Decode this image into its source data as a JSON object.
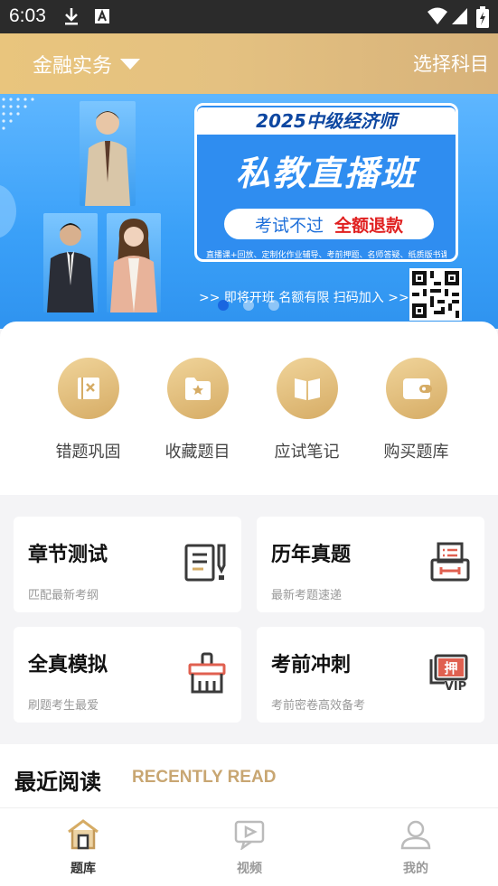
{
  "status_bar": {
    "time": "6:03",
    "icons": [
      "download-icon",
      "font-icon",
      "wifi-icon",
      "signal-icon",
      "battery-icon"
    ]
  },
  "header": {
    "subject": "金融实务",
    "choose_subject": "选择科目"
  },
  "banner": {
    "year_line": "2025中级经济师",
    "title": "私教直播班",
    "pill_left": "考试不过",
    "pill_right": "全额退款",
    "features": "直播课+回放、定制化作业辅导、考前押题、名师答疑、纸质版书课包",
    "cta": ">> 即将开班 名额有限 扫码加入 >>",
    "carousel_count": 3,
    "carousel_active": 0
  },
  "quick_actions": [
    {
      "label": "错题巩固",
      "icon": "wrong-questions-icon"
    },
    {
      "label": "收藏题目",
      "icon": "favorite-folder-icon"
    },
    {
      "label": "应试笔记",
      "icon": "notes-book-icon"
    },
    {
      "label": "购买题库",
      "icon": "wallet-icon"
    }
  ],
  "cards": [
    {
      "title": "章节测试",
      "subtitle": "匹配最新考纲",
      "icon": "chapter-test-icon"
    },
    {
      "title": "历年真题",
      "subtitle": "最新考题速递",
      "icon": "past-papers-icon"
    },
    {
      "title": "全真模拟",
      "subtitle": "刷题考生最爱",
      "icon": "mock-exam-icon"
    },
    {
      "title": "考前冲刺",
      "subtitle": "考前密卷高效备考",
      "icon": "vip-sprint-icon"
    }
  ],
  "card_icon_text": {
    "ya": "押",
    "vip": "VIP"
  },
  "recent": {
    "title": "最近阅读",
    "subtitle": "RECENTLY READ"
  },
  "tabs": [
    {
      "label": "题库",
      "icon": "question-bank-icon",
      "active": true
    },
    {
      "label": "视频",
      "icon": "video-icon",
      "active": false
    },
    {
      "label": "我的",
      "icon": "profile-icon",
      "active": false
    }
  ],
  "colors": {
    "accent": "#d6ac65",
    "icon_dark": "#3a3a3a",
    "banner_blue": "#3aa0f8",
    "refund_red": "#e02020"
  }
}
